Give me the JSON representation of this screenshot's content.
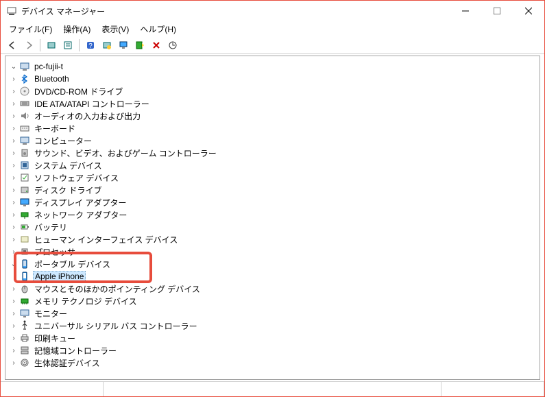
{
  "window": {
    "title": "デバイス マネージャー"
  },
  "menubar": {
    "file": "ファイル(F)",
    "action": "操作(A)",
    "view": "表示(V)",
    "help": "ヘルプ(H)"
  },
  "toolbar": {
    "back": "←",
    "forward": "→",
    "show_hidden": "",
    "properties": "",
    "help": "?",
    "refresh": "",
    "monitor": "",
    "update": "",
    "uninstall": "✖",
    "scan": ""
  },
  "tree": {
    "root": {
      "label": "pc-fujii-t",
      "icon": "computer-icon"
    },
    "items": [
      {
        "label": "Bluetooth",
        "icon": "bluetooth-icon",
        "expanded": false
      },
      {
        "label": "DVD/CD-ROM ドライブ",
        "icon": "disc-icon",
        "expanded": false
      },
      {
        "label": "IDE ATA/ATAPI コントローラー",
        "icon": "ide-icon",
        "expanded": false
      },
      {
        "label": "オーディオの入力および出力",
        "icon": "audio-icon",
        "expanded": false
      },
      {
        "label": "キーボード",
        "icon": "keyboard-icon",
        "expanded": false
      },
      {
        "label": "コンピューター",
        "icon": "computer-icon",
        "expanded": false
      },
      {
        "label": "サウンド、ビデオ、およびゲーム コントローラー",
        "icon": "sound-icon",
        "expanded": false
      },
      {
        "label": "システム デバイス",
        "icon": "system-icon",
        "expanded": false
      },
      {
        "label": "ソフトウェア デバイス",
        "icon": "software-icon",
        "expanded": false
      },
      {
        "label": "ディスク ドライブ",
        "icon": "disk-icon",
        "expanded": false
      },
      {
        "label": "ディスプレイ アダプター",
        "icon": "display-icon",
        "expanded": false
      },
      {
        "label": "ネットワーク アダプター",
        "icon": "network-icon",
        "expanded": false
      },
      {
        "label": "バッテリ",
        "icon": "battery-icon",
        "expanded": false
      },
      {
        "label": "ヒューマン インターフェイス デバイス",
        "icon": "hid-icon",
        "expanded": false
      },
      {
        "label": "プロセッサ",
        "icon": "cpu-icon",
        "expanded": false
      },
      {
        "label": "ポータブル デバイス",
        "icon": "portable-icon",
        "expanded": true,
        "children": [
          {
            "label": "Apple iPhone",
            "icon": "phone-icon",
            "selected": true
          }
        ]
      },
      {
        "label": "マウスとそのほかのポインティング デバイス",
        "icon": "mouse-icon",
        "expanded": false
      },
      {
        "label": "メモリ テクノロジ デバイス",
        "icon": "memory-icon",
        "expanded": false
      },
      {
        "label": "モニター",
        "icon": "monitor-icon",
        "expanded": false
      },
      {
        "label": "ユニバーサル シリアル バス コントローラー",
        "icon": "usb-icon",
        "expanded": false
      },
      {
        "label": "印刷キュー",
        "icon": "printer-icon",
        "expanded": false
      },
      {
        "label": "記憶域コントローラー",
        "icon": "storage-icon",
        "expanded": false
      },
      {
        "label": "生体認証デバイス",
        "icon": "biometric-icon",
        "expanded": false
      }
    ]
  }
}
